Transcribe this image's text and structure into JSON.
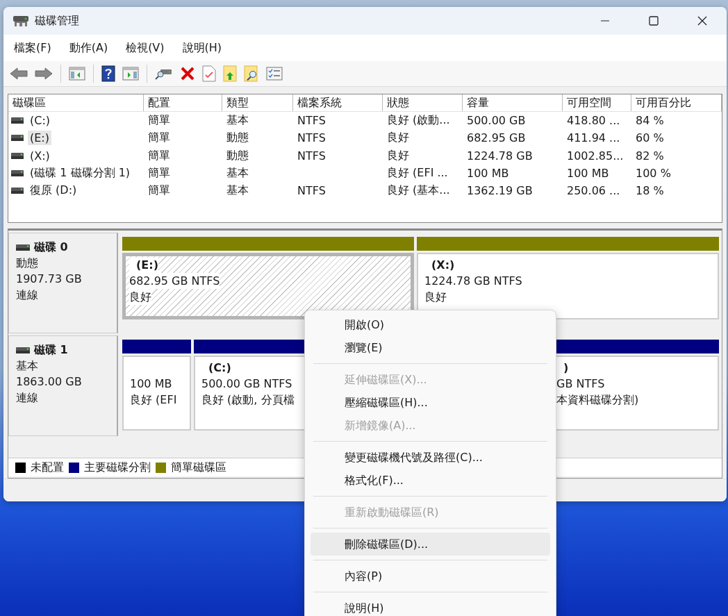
{
  "window": {
    "title": "磁碟管理"
  },
  "menu_bar": [
    "檔案(F)",
    "動作(A)",
    "檢視(V)",
    "說明(H)"
  ],
  "volume_table": {
    "columns": [
      "磁碟區",
      "配置",
      "類型",
      "檔案系統",
      "狀態",
      "容量",
      "可用空間",
      "可用百分比"
    ],
    "rows": [
      {
        "selected": false,
        "cells": [
          "(C:)",
          "簡單",
          "基本",
          "NTFS",
          "良好 (啟動...",
          "500.00 GB",
          "418.80 ...",
          "84 %"
        ]
      },
      {
        "selected": true,
        "cells": [
          "(E:)",
          "簡單",
          "動態",
          "NTFS",
          "良好",
          "682.95 GB",
          "411.94 ...",
          "60 %"
        ]
      },
      {
        "selected": false,
        "cells": [
          "(X:)",
          "簡單",
          "動態",
          "NTFS",
          "良好",
          "1224.78 GB",
          "1002.85...",
          "82 %"
        ]
      },
      {
        "selected": false,
        "cells": [
          "(磁碟 1 磁碟分割 1)",
          "簡單",
          "基本",
          null,
          "良好 (EFI ...",
          "100 MB",
          "100 MB",
          "100 %"
        ]
      },
      {
        "selected": false,
        "cells": [
          "復原 (D:)",
          "簡單",
          "基本",
          "NTFS",
          "良好 (基本...",
          "1362.19 GB",
          "250.06 ...",
          "18 %"
        ]
      }
    ]
  },
  "disks": [
    {
      "name": "磁碟 0",
      "type": "動態",
      "size": "1907.73 GB",
      "status": "連線",
      "partitions": [
        {
          "color": "#808000",
          "selected": true,
          "label": "(E:)",
          "size": "682.95 GB NTFS",
          "status": "良好"
        },
        {
          "color": "#808000",
          "selected": false,
          "label": "(X:)",
          "size": "1224.78 GB NTFS",
          "status": "良好"
        }
      ]
    },
    {
      "name": "磁碟 1",
      "type": "基本",
      "size": "1863.00 GB",
      "status": "連線",
      "partitions": [
        {
          "color": "#000080",
          "selected": false,
          "size": "100 MB",
          "status": "良好 (EFI"
        },
        {
          "color": "#000080",
          "selected": false,
          "label": "(C:)",
          "size": "500.00 GB NTFS",
          "status": "良好 (啟動, 分頁檔"
        },
        {
          "color": "#000080",
          "selected": false,
          "label": ")",
          "size": "GB NTFS",
          "status": "本資料磁碟分割)"
        }
      ]
    }
  ],
  "legend": [
    {
      "label": "未配置",
      "color": "#000000"
    },
    {
      "label": "主要磁碟分割",
      "color": "#000080"
    },
    {
      "label": "簡單磁碟區",
      "color": "#808000"
    }
  ],
  "context_menu": [
    {
      "kind": "item",
      "label": "開啟(O)",
      "disabled": false,
      "selected": false
    },
    {
      "kind": "item",
      "label": "瀏覽(E)",
      "disabled": false,
      "selected": false
    },
    {
      "kind": "separator"
    },
    {
      "kind": "item",
      "label": "延伸磁碟區(X)...",
      "disabled": true,
      "selected": false
    },
    {
      "kind": "item",
      "label": "壓縮磁碟區(H)...",
      "disabled": false,
      "selected": false
    },
    {
      "kind": "item",
      "label": "新增鏡像(A)...",
      "disabled": true,
      "selected": false
    },
    {
      "kind": "separator"
    },
    {
      "kind": "item",
      "label": "變更磁碟機代號及路徑(C)...",
      "disabled": false,
      "selected": false
    },
    {
      "kind": "item",
      "label": "格式化(F)...",
      "disabled": false,
      "selected": false
    },
    {
      "kind": "separator"
    },
    {
      "kind": "item",
      "label": "重新啟動磁碟區(R)",
      "disabled": true,
      "selected": false
    },
    {
      "kind": "separator"
    },
    {
      "kind": "item",
      "label": "刪除磁碟區(D)...",
      "disabled": false,
      "selected": true
    },
    {
      "kind": "separator"
    },
    {
      "kind": "item",
      "label": "內容(P)",
      "disabled": false,
      "selected": false
    },
    {
      "kind": "separator"
    },
    {
      "kind": "item",
      "label": "說明(H)",
      "disabled": false,
      "selected": false
    }
  ]
}
